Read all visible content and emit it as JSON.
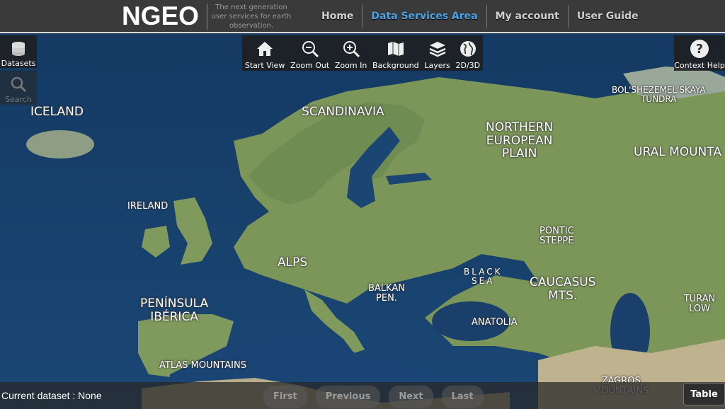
{
  "header": {
    "brand": "NGEO",
    "tagline": "The next generation user services for earth observation.",
    "nav": [
      {
        "label": "Home"
      },
      {
        "label": "Data Services Area"
      },
      {
        "label": "My account"
      },
      {
        "label": "User Guide"
      }
    ]
  },
  "toolbar": {
    "items": [
      {
        "label": "Start View",
        "icon": "home-icon"
      },
      {
        "label": "Zoom Out",
        "icon": "zoom-out-icon"
      },
      {
        "label": "Zoom In",
        "icon": "zoom-in-icon"
      },
      {
        "label": "Background",
        "icon": "map-icon"
      },
      {
        "label": "Layers",
        "icon": "layers-icon"
      },
      {
        "label": "2D/3D",
        "icon": "globe-icon"
      }
    ]
  },
  "sidebar": {
    "datasets_label": "Datasets",
    "search_label": "Search"
  },
  "help": {
    "label": "Context Help"
  },
  "map_labels": {
    "iceland": "ICELAND",
    "scandinavia": "SCANDINAVIA",
    "north_plain": "NORTHERN\nEUROPEAN\nPLAIN",
    "bolshezemel": "BOL'SHEZEMEL'SKAYA\nTUNDRA",
    "ural": "URAL MOUNTA",
    "ireland": "IRELAND",
    "pontic": "PONTIC\nSTEPPE",
    "alps": "ALPS",
    "black_sea": "BLACK\nSEA",
    "caucasus": "CAUCASUS\nMTS.",
    "balkan": "BALKAN\nPEN.",
    "iberica": "PENÍNSULA\nIBÉRICA",
    "turan": "TURAN LOW",
    "anatolia": "ANATOLIA",
    "atlas": "ATLAS MOUNTAINS",
    "zagros": "ZAGROS\nMOUNTAINS"
  },
  "bottom": {
    "current_dataset": "Current dataset : None",
    "pager": [
      "First",
      "Previous",
      "Next",
      "Last"
    ],
    "table_label": "Table"
  },
  "colors": {
    "ocean": "#1d3d5e",
    "land": "#7f9a5c",
    "accent": "#4aa3e6"
  }
}
